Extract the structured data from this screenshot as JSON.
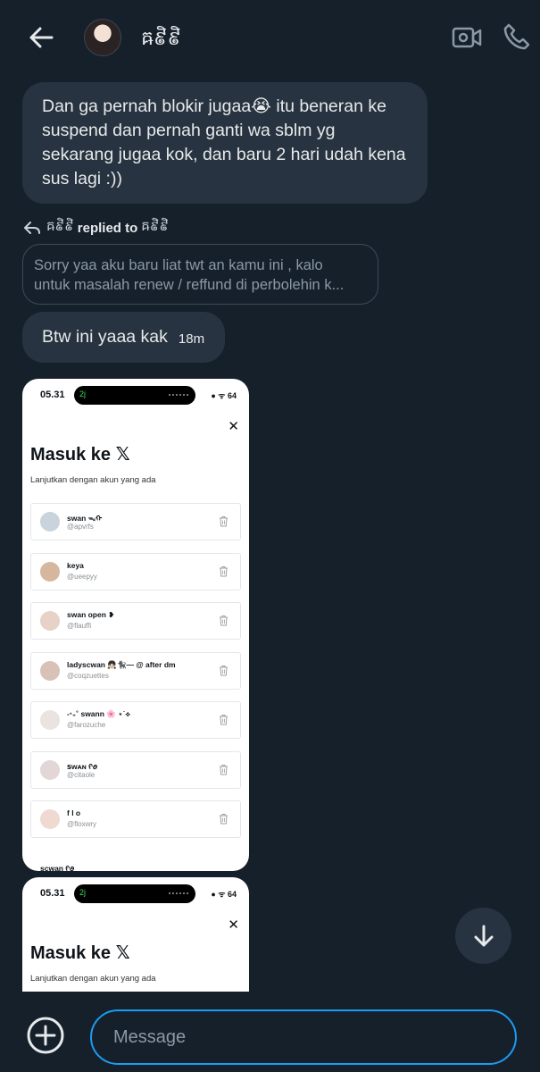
{
  "header": {
    "contact_name": "ឝ៩ិ៩ិ",
    "back_icon": "arrow-left-icon",
    "video_icon": "video-camera-icon",
    "call_icon": "phone-icon"
  },
  "messages": [
    {
      "text": "Dan ga pernah blokir jugaa😭 itu beneran ke suspend dan pernah ganti wa sblm yg sekarang jugaa kok, dan baru 2 hari udah kena sus lagi :))"
    }
  ],
  "reply": {
    "sender": "ឝ៩ិ៩ិ",
    "connector": "replied to",
    "recipient": "ឝ៩ិ៩ិ",
    "quoted_line1": "Sorry yaa aku baru liat twt an kamu ini , kalo",
    "quoted_line2": "untuk masalah renew / reffund di perbolehin k..."
  },
  "message2": {
    "text": "Btw ini yaaa kak",
    "time": "18m"
  },
  "screenshot": {
    "status_time": "05.31",
    "call_label": "2j",
    "status_icons": "● ᯤ 64",
    "title": "Masuk ke 𝕏",
    "subtitle": "Lanjutkan dengan akun yang ada",
    "accounts": [
      {
        "name": "swan ᯓᡣ",
        "handle": "@apvrfs",
        "avatar_color": "#c9d3dc"
      },
      {
        "name": "keya",
        "handle": "@ueepyy",
        "avatar_color": "#d6b79e"
      },
      {
        "name": "swan open ❥",
        "handle": "@flauffi",
        "avatar_color": "#e7d2c8"
      },
      {
        "name": "ladyscwan 👧🏻🐈‍⬛— @ after dm",
        "handle": "@coqzuettes",
        "avatar_color": "#d8c2b8"
      },
      {
        "name": "-‧₊˚ swann 🌸 ⋆˙⟡",
        "handle": "@farozuche",
        "avatar_color": "#ebe3e0"
      },
      {
        "name": "ꜱᴡᴀɴ ᠻꪮ",
        "handle": "@citaole",
        "avatar_color": "#e2d6d6"
      },
      {
        "name": "f l o",
        "handle": "@floxwry",
        "avatar_color": "#efd9d0"
      }
    ],
    "partial_name": "scwan ᠻꪮ"
  },
  "composer": {
    "placeholder": "Message",
    "plus_icon": "plus-circle-icon"
  },
  "colors": {
    "background": "#15202b",
    "bubble": "#273340",
    "accent": "#1d9bf0"
  }
}
